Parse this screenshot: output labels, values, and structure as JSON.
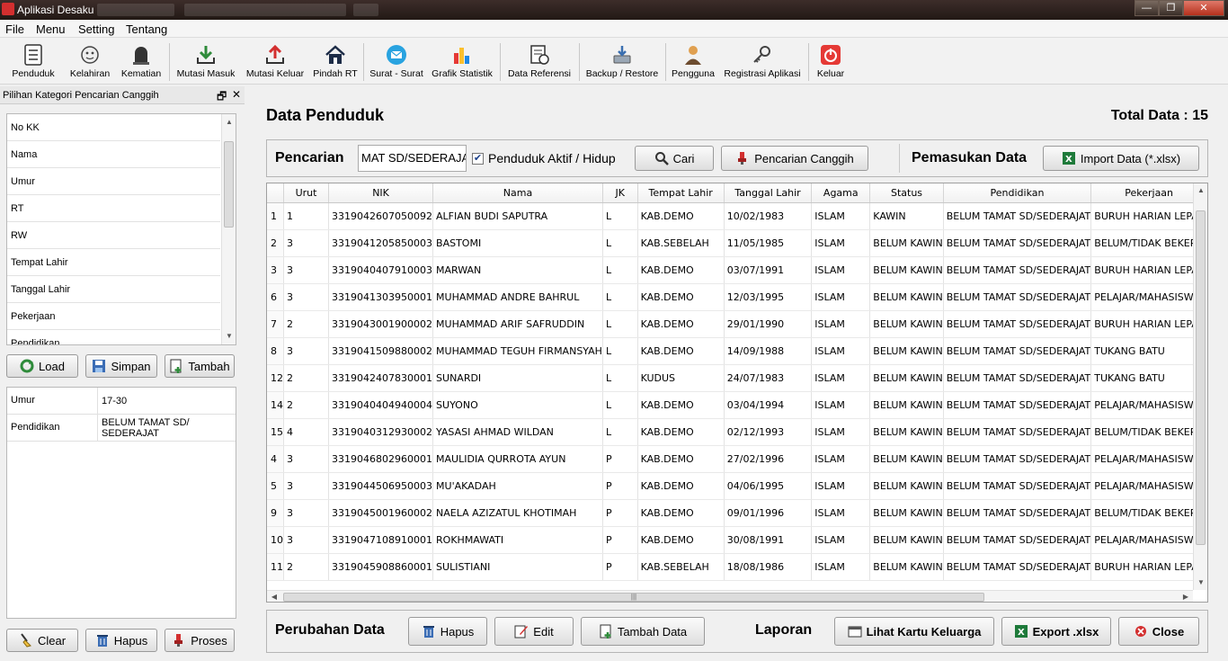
{
  "window": {
    "title": "Aplikasi Desaku",
    "minimize": "—",
    "maximize": "❐",
    "close": "✕"
  },
  "menu": [
    "File",
    "Menu",
    "Setting",
    "Tentang"
  ],
  "toolbar": {
    "penduduk": "Penduduk",
    "kelahiran": "Kelahiran",
    "kematian": "Kematian",
    "mutasi_masuk": "Mutasi Masuk",
    "mutasi_keluar": "Mutasi Keluar",
    "pindah_rt": "Pindah RT",
    "surat": "Surat - Surat",
    "grafik": "Grafik Statistik",
    "data_referensi": "Data Referensi",
    "backup": "Backup / Restore",
    "pengguna": "Pengguna",
    "registrasi": "Registrasi Aplikasi",
    "keluar": "Keluar"
  },
  "left_panel": {
    "title": "Pilihan Kategori Pencarian Canggih",
    "restore_glyph": "🗗",
    "close_glyph": "✕",
    "categories": [
      "No KK",
      "Nama",
      "Umur",
      "RT",
      "RW",
      "Tempat Lahir",
      "Tanggal Lahir",
      "Pekerjaan",
      "Pendidikan"
    ],
    "load_label": "Load",
    "simpan_label": "Simpan",
    "tambah_label": "Tambah",
    "filters": [
      {
        "key": "Umur",
        "value": "17-30"
      },
      {
        "key": "Pendidikan",
        "value": "BELUM TAMAT SD/ SEDERAJAT"
      }
    ],
    "clear_label": "Clear",
    "hapus_label": "Hapus",
    "proses_label": "Proses"
  },
  "main": {
    "title": "Data Penduduk",
    "total": "Total Data : 15",
    "search_label": "Pencarian",
    "search_value": "MAT SD/SEDERAJAT",
    "active_checkbox_label": "Penduduk Aktif / Hidup",
    "active_checked": true,
    "cari_label": "Cari",
    "canggih_label": "Pencarian Canggih",
    "pemasukan_label": "Pemasukan Data",
    "import_label": "Import Data (*.xlsx)"
  },
  "table": {
    "columns": [
      "",
      "Urut",
      "NIK",
      "Nama",
      "JK",
      "Tempat Lahir",
      "Tanggal Lahir",
      "Agama",
      "Status",
      "Pendidikan",
      "Pekerjaan"
    ],
    "rows": [
      [
        "1",
        "1",
        "3319042607050092",
        "ALFIAN BUDI SAPUTRA",
        "L",
        "KAB.DEMO",
        "10/02/1983",
        "ISLAM",
        "KAWIN",
        "BELUM TAMAT SD/SEDERAJAT",
        "BURUH HARIAN LEPAS"
      ],
      [
        "2",
        "3",
        "3319041205850003",
        "BASTOMI",
        "L",
        "KAB.SEBELAH",
        "11/05/1985",
        "ISLAM",
        "BELUM KAWIN",
        "BELUM TAMAT SD/SEDERAJAT",
        "BELUM/TIDAK BEKERJA"
      ],
      [
        "3",
        "3",
        "3319040407910003",
        "MARWAN",
        "L",
        "KAB.DEMO",
        "03/07/1991",
        "ISLAM",
        "BELUM KAWIN",
        "BELUM TAMAT SD/SEDERAJAT",
        "BURUH HARIAN LEPAS"
      ],
      [
        "6",
        "3",
        "3319041303950001",
        "MUHAMMAD ANDRE BAHRUL",
        "L",
        "KAB.DEMO",
        "12/03/1995",
        "ISLAM",
        "BELUM KAWIN",
        "BELUM TAMAT SD/SEDERAJAT",
        "PELAJAR/MAHASISWA"
      ],
      [
        "7",
        "2",
        "3319043001900002",
        "MUHAMMAD ARIF SAFRUDDIN",
        "L",
        "KAB.DEMO",
        "29/01/1990",
        "ISLAM",
        "BELUM KAWIN",
        "BELUM TAMAT SD/SEDERAJAT",
        "BURUH HARIAN LEPAS"
      ],
      [
        "8",
        "3",
        "3319041509880002",
        "MUHAMMAD TEGUH FIRMANSYAH",
        "L",
        "KAB.DEMO",
        "14/09/1988",
        "ISLAM",
        "BELUM KAWIN",
        "BELUM TAMAT SD/SEDERAJAT",
        "TUKANG BATU"
      ],
      [
        "12",
        "2",
        "3319042407830001",
        "SUNARDI",
        "L",
        "KUDUS",
        "24/07/1983",
        "ISLAM",
        "BELUM KAWIN",
        "BELUM TAMAT SD/SEDERAJAT",
        "TUKANG BATU"
      ],
      [
        "14",
        "2",
        "3319040404940004",
        "SUYONO",
        "L",
        "KAB.DEMO",
        "03/04/1994",
        "ISLAM",
        "BELUM KAWIN",
        "BELUM TAMAT SD/SEDERAJAT",
        "PELAJAR/MAHASISWA"
      ],
      [
        "15",
        "4",
        "3319040312930002",
        "YASASI AHMAD WILDAN",
        "L",
        "KAB.DEMO",
        "02/12/1993",
        "ISLAM",
        "BELUM KAWIN",
        "BELUM TAMAT SD/SEDERAJAT",
        "BELUM/TIDAK BEKERJA"
      ],
      [
        "4",
        "3",
        "3319046802960001",
        "MAULIDIA QURROTA AYUN",
        "P",
        "KAB.DEMO",
        "27/02/1996",
        "ISLAM",
        "BELUM KAWIN",
        "BELUM TAMAT SD/SEDERAJAT",
        "PELAJAR/MAHASISWA"
      ],
      [
        "5",
        "3",
        "3319044506950003",
        "MU'AKADAH",
        "P",
        "KAB.DEMO",
        "04/06/1995",
        "ISLAM",
        "BELUM KAWIN",
        "BELUM TAMAT SD/SEDERAJAT",
        "PELAJAR/MAHASISWA"
      ],
      [
        "9",
        "3",
        "3319045001960002",
        "NAELA AZIZATUL KHOTIMAH",
        "P",
        "KAB.DEMO",
        "09/01/1996",
        "ISLAM",
        "BELUM KAWIN",
        "BELUM TAMAT SD/SEDERAJAT",
        "BELUM/TIDAK BEKERJA"
      ],
      [
        "10",
        "3",
        "3319047108910001",
        "ROKHMAWATI",
        "P",
        "KAB.DEMO",
        "30/08/1991",
        "ISLAM",
        "BELUM KAWIN",
        "BELUM TAMAT SD/SEDERAJAT",
        "PELAJAR/MAHASISWA"
      ],
      [
        "11",
        "2",
        "3319045908860001",
        "SULISTIANI",
        "P",
        "KAB.SEBELAH",
        "18/08/1986",
        "ISLAM",
        "BELUM KAWIN",
        "BELUM TAMAT SD/SEDERAJAT",
        "BURUH HARIAN LEPAS"
      ]
    ]
  },
  "bottom": {
    "perubahan_label": "Perubahan Data",
    "hapus_label": "Hapus",
    "edit_label": "Edit",
    "tambah_label": "Tambah Data",
    "laporan_label": "Laporan",
    "kk_label": "Lihat Kartu Keluarga",
    "export_label": "Export .xlsx",
    "close_label": "Close"
  },
  "colors": {
    "title_bar": "#2b1f1b",
    "close_red": "#c0392b",
    "excel_green": "#1e7a3a",
    "accent_blue": "#1b5fa8"
  }
}
